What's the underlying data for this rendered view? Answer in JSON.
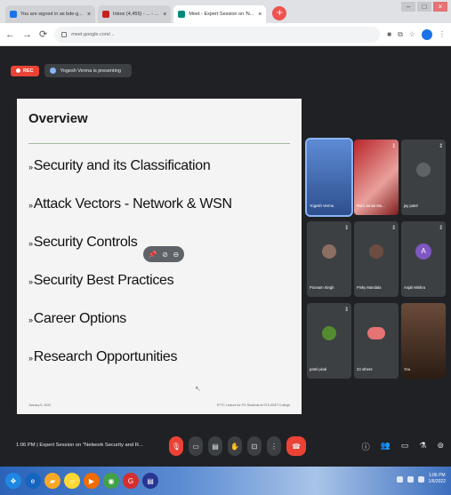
{
  "browser": {
    "tabs": [
      {
        "label": "You are signed in as bde-g...",
        "favicon_color": "#1a73e8",
        "active": false
      },
      {
        "label": "Inbox (4,455) - ... - ...",
        "favicon_color": "#c5221f",
        "active": false
      },
      {
        "label": "Meet - Expert Session on 'N...",
        "favicon_color": "#00897b",
        "active": true
      }
    ],
    "new_tab_symbol": "+",
    "window_controls": [
      "–",
      "□",
      "×"
    ],
    "address": "meet.google.com/..."
  },
  "meet": {
    "rec_label": "REC",
    "presenter_text": "Yogesh Verma is presenting",
    "meeting_info": "1:06 PM | Expert Session on \"Network Security and R...",
    "slide": {
      "title": "Overview",
      "bullets": [
        "Security and its Classification",
        "Attack Vectors - Network & WSN",
        "Security Controls",
        "Security Best Practices",
        "Career Options",
        "Research Opportunities"
      ],
      "footer_left": "January 6, 2022",
      "footer_right": "STTC Lecture for PG Students at STU ASET College"
    },
    "participants": [
      {
        "name": "Yogesh Verma",
        "kind": "video"
      },
      {
        "name": "Ram Janak Ma...",
        "kind": "video"
      },
      {
        "name": "jay patel",
        "kind": "avatar",
        "color": "#5f6368"
      },
      {
        "name": "Poonam Singh",
        "kind": "avatar",
        "color": "#8d6e63"
      },
      {
        "name": "Pinky Mandala",
        "kind": "avatar",
        "color": "#6d4c41"
      },
      {
        "name": "Anjali Mishra",
        "kind": "initial",
        "initial": "A",
        "color": "#7e57c2"
      },
      {
        "name": "patel pinal",
        "kind": "avatar",
        "color": "#558b2f"
      },
      {
        "name": "23 others",
        "kind": "group",
        "color": "#e57373"
      },
      {
        "name": "You",
        "kind": "video"
      }
    ]
  },
  "taskbar": {
    "clock_time": "1:06 PM",
    "clock_date": "1/6/2022"
  }
}
